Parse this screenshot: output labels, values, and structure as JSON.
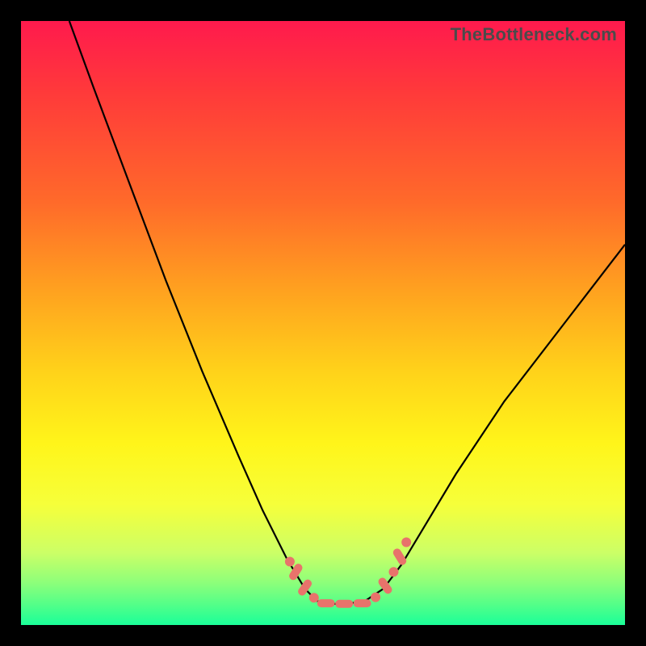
{
  "watermark": "TheBottleneck.com",
  "colors": {
    "marker": "#e8736b",
    "curve": "#000000",
    "frame": "#000000"
  },
  "chart_data": {
    "type": "line",
    "title": "",
    "xlabel": "",
    "ylabel": "",
    "xlim": [
      0,
      100
    ],
    "ylim": [
      0,
      100
    ],
    "grid": false,
    "legend": false,
    "note": "Values estimated from pixel positions; axes are unlabeled in source. y≈0 is at the bottom (green), y≈100 at the top (red).",
    "series": [
      {
        "name": "curve",
        "x": [
          8,
          12,
          18,
          24,
          30,
          36,
          40,
          44,
          47,
          49,
          51,
          54,
          57,
          60,
          63,
          66,
          72,
          80,
          90,
          100
        ],
        "y": [
          100,
          89,
          73,
          57,
          42,
          28,
          19,
          11,
          6,
          4,
          3.5,
          3.5,
          4,
          6,
          10,
          15,
          25,
          37,
          50,
          63
        ]
      }
    ],
    "markers": [
      {
        "shape": "dot",
        "x": 44.5,
        "y": 10.5
      },
      {
        "shape": "oblong",
        "x": 45.5,
        "y": 8.8,
        "angle": -58
      },
      {
        "shape": "oblong",
        "x": 47.0,
        "y": 6.2,
        "angle": -55
      },
      {
        "shape": "dot",
        "x": 48.5,
        "y": 4.5
      },
      {
        "shape": "oblong",
        "x": 50.5,
        "y": 3.6,
        "angle": 0
      },
      {
        "shape": "oblong",
        "x": 53.5,
        "y": 3.5,
        "angle": 0
      },
      {
        "shape": "oblong",
        "x": 56.5,
        "y": 3.6,
        "angle": 0
      },
      {
        "shape": "dot",
        "x": 58.7,
        "y": 4.6
      },
      {
        "shape": "oblong",
        "x": 60.3,
        "y": 6.5,
        "angle": 55
      },
      {
        "shape": "dot",
        "x": 61.7,
        "y": 8.8
      },
      {
        "shape": "oblong",
        "x": 62.7,
        "y": 11.3,
        "angle": 58
      },
      {
        "shape": "dot",
        "x": 63.8,
        "y": 13.7
      }
    ]
  }
}
